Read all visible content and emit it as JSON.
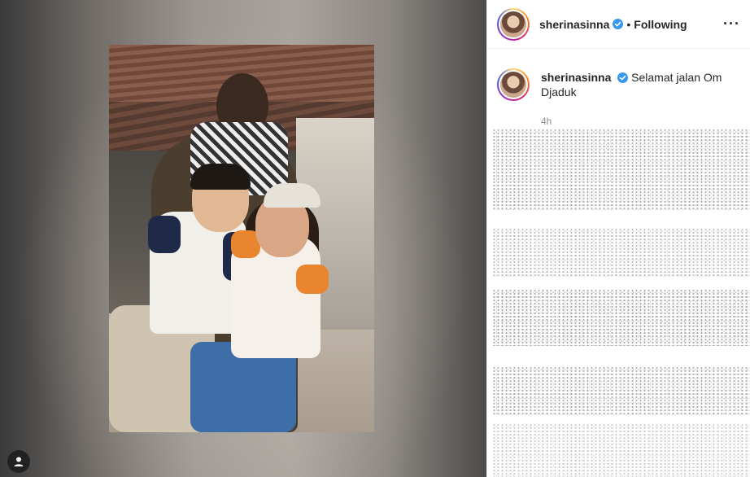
{
  "post": {
    "username": "sherinasinna",
    "follow_status": "Following",
    "separator": "•",
    "more_label": "···",
    "caption": "Selamat jalan Om Djaduk",
    "time_ago": "4h"
  },
  "colors": {
    "verified_badge": "#3897f0",
    "text_primary": "#262626",
    "text_secondary": "#8e8e8e"
  },
  "icons": {
    "verified": "verified-badge-icon",
    "more": "more-options-icon",
    "account": "user-account-icon"
  }
}
